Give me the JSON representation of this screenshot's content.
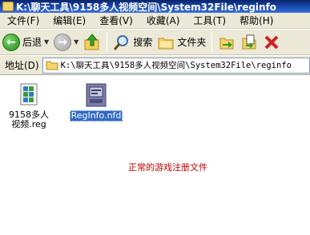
{
  "window": {
    "title": "K:\\聊天工具\\9158多人视频空间\\System32File\\reginfo"
  },
  "menu": [
    {
      "label": "文件(F)"
    },
    {
      "label": "编辑(E)"
    },
    {
      "label": "查看(V)"
    },
    {
      "label": "收藏(A)"
    },
    {
      "label": "工具(T)"
    },
    {
      "label": "帮助(H)"
    }
  ],
  "toolbar": {
    "back_label": "后退",
    "search_label": "搜索",
    "folders_label": "文件夹"
  },
  "address": {
    "label": "地址(D)",
    "value": "K:\\聊天工具\\9158多人视频空间\\System32File\\reginfo"
  },
  "files": [
    {
      "name": "9158多人视频.reg",
      "icon": "registry-file-icon",
      "selected": false
    },
    {
      "name": "RegInfo.nfd",
      "icon": "nfd-file-icon",
      "selected": true
    }
  ],
  "note": "正常的游戏注册文件",
  "colors": {
    "titlebar": "#0a246a",
    "chrome": "#ece9d8",
    "selection": "#316ac5",
    "note": "#c00000"
  }
}
